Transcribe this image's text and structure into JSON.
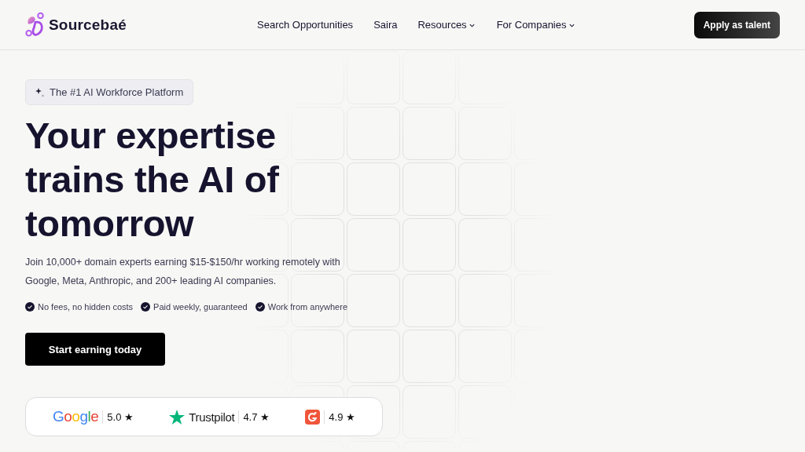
{
  "header": {
    "logo": "Sourcebaé",
    "nav": [
      {
        "label": "Search Opportunities",
        "dropdown": false
      },
      {
        "label": "Saira",
        "dropdown": false
      },
      {
        "label": "Resources",
        "dropdown": true
      },
      {
        "label": "For Companies",
        "dropdown": true
      }
    ],
    "cta": "Apply as talent"
  },
  "hero": {
    "badge": "The #1 AI Workforce Platform",
    "headline": "Your expertise trains the AI of tomorrow",
    "description": "Join 10,000+ domain experts earning $15-$150/hr working remotely with Google, Meta, Anthropic, and 200+ leading AI companies.",
    "perks": [
      "No fees, no hidden costs",
      "Paid weekly, guaranteed",
      "Work from anywhere"
    ],
    "button": "Start earning today",
    "ratings": [
      {
        "kind": "google",
        "name": "Google",
        "score": "5.0",
        "star": "★"
      },
      {
        "kind": "trustpilot",
        "name": "Trustpilot",
        "score": "4.7",
        "star": "★"
      },
      {
        "kind": "g2",
        "score": "4.9",
        "star": "★"
      }
    ]
  }
}
